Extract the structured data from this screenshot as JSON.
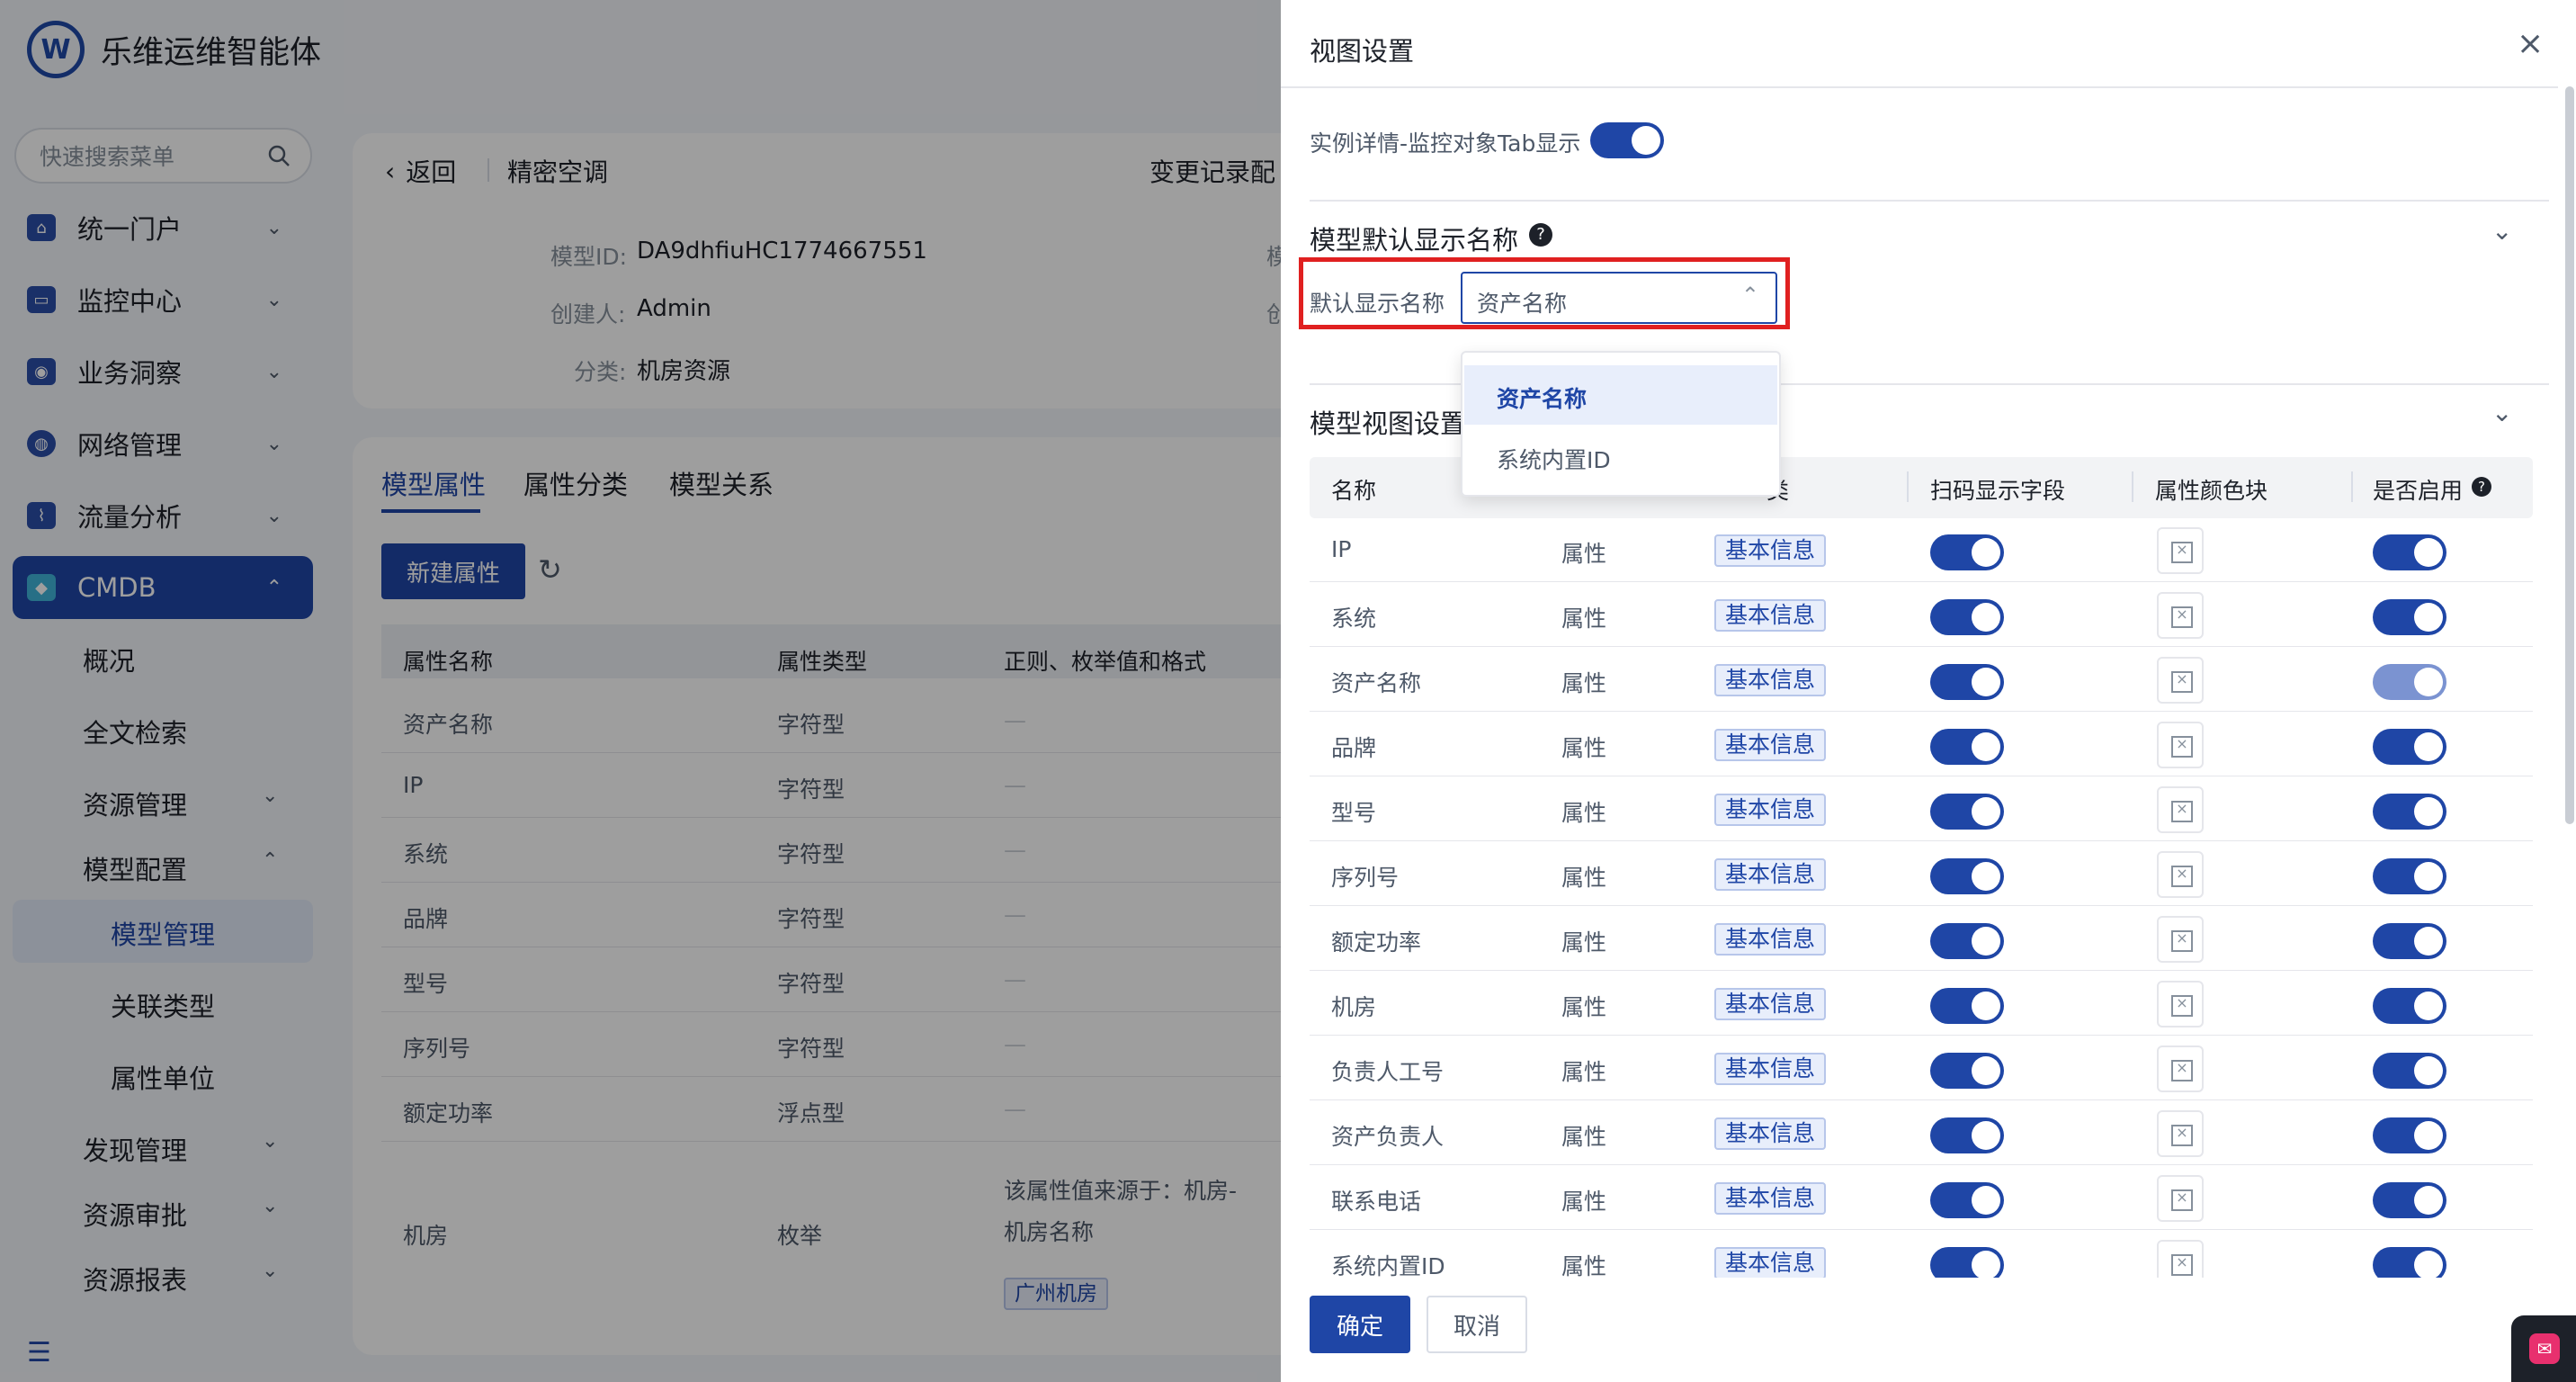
{
  "app": {
    "logo_mark": "W",
    "title": "乐维运维智能体"
  },
  "search": {
    "placeholder": "快速搜索菜单"
  },
  "menu": [
    {
      "label": "统一门户"
    },
    {
      "label": "监控中心"
    },
    {
      "label": "业务洞察"
    },
    {
      "label": "网络管理"
    },
    {
      "label": "流量分析"
    },
    {
      "label": "CMDB"
    }
  ],
  "cmdb_sub": {
    "overview": "概况",
    "fulltext": "全文检索",
    "resource_mgmt": "资源管理",
    "model_config": "模型配置",
    "model_mgmt": "模型管理",
    "relation_type": "关联类型",
    "attr_unit": "属性单位",
    "discovery": "发现管理",
    "approval": "资源审批",
    "report": "资源报表"
  },
  "header": {
    "back": "返回",
    "model_name": "精密空调",
    "change_record": "变更记录配",
    "model_id_label": "模型ID:",
    "model_id_value": "DA9dhfiuHC1774667551",
    "creator_label": "创建人:",
    "creator_value": "Admin",
    "category_label": "分类:",
    "category_value": "机房资源",
    "side_trunc1": "模",
    "side_trunc2": "创"
  },
  "tabs": [
    "模型属性",
    "属性分类",
    "模型关系"
  ],
  "toolbar": {
    "new_attr": "新建属性"
  },
  "attr_table": {
    "headers": [
      "属性名称",
      "属性类型",
      "正则、枚举值和格式"
    ],
    "rows": [
      {
        "name": "资产名称",
        "type": "字符型",
        "rule": "—"
      },
      {
        "name": "IP",
        "type": "字符型",
        "rule": "—"
      },
      {
        "name": "系统",
        "type": "字符型",
        "rule": "—"
      },
      {
        "name": "品牌",
        "type": "字符型",
        "rule": "—"
      },
      {
        "name": "型号",
        "type": "字符型",
        "rule": "—"
      },
      {
        "name": "序列号",
        "type": "字符型",
        "rule": "—"
      },
      {
        "name": "额定功率",
        "type": "浮点型",
        "rule": "—"
      }
    ],
    "last_row": {
      "name": "机房",
      "type": "枚举",
      "rule_line1": "该属性值来源于：机房-",
      "rule_line2": "机房名称",
      "tag": "广州机房"
    }
  },
  "panel": {
    "title": "视图设置",
    "close": "×",
    "tab_display_label": "实例详情-监控对象Tab显示",
    "tab_display_on": true,
    "section1_title": "模型默认显示名称",
    "default_name_label": "默认显示名称",
    "default_name_value": "资产名称",
    "dropdown_options": [
      "资产名称",
      "系统内置ID"
    ],
    "dropdown_selected": "资产名称",
    "section2_title": "模型视图设置",
    "table_headers": {
      "name": "名称",
      "col2": "",
      "group": "类",
      "scan": "扫码显示字段",
      "color": "属性颜色块",
      "enabled": "是否启用"
    },
    "rows": [
      {
        "name": "IP",
        "kind": "属性",
        "group": "基本信息",
        "enabled_light": false
      },
      {
        "name": "系统",
        "kind": "属性",
        "group": "基本信息",
        "enabled_light": false
      },
      {
        "name": "资产名称",
        "kind": "属性",
        "group": "基本信息",
        "enabled_light": true
      },
      {
        "name": "品牌",
        "kind": "属性",
        "group": "基本信息",
        "enabled_light": false
      },
      {
        "name": "型号",
        "kind": "属性",
        "group": "基本信息",
        "enabled_light": false
      },
      {
        "name": "序列号",
        "kind": "属性",
        "group": "基本信息",
        "enabled_light": false
      },
      {
        "name": "额定功率",
        "kind": "属性",
        "group": "基本信息",
        "enabled_light": false
      },
      {
        "name": "机房",
        "kind": "属性",
        "group": "基本信息",
        "enabled_light": false
      },
      {
        "name": "负责人工号",
        "kind": "属性",
        "group": "基本信息",
        "enabled_light": false
      },
      {
        "name": "资产负责人",
        "kind": "属性",
        "group": "基本信息",
        "enabled_light": false
      },
      {
        "name": "联系电话",
        "kind": "属性",
        "group": "基本信息",
        "enabled_light": false
      },
      {
        "name": "系统内置ID",
        "kind": "属性",
        "group": "基本信息",
        "enabled_light": false
      }
    ],
    "confirm": "确定",
    "cancel": "取消"
  },
  "colors": {
    "primary": "#1f46a6",
    "highlight": "#e02020"
  }
}
